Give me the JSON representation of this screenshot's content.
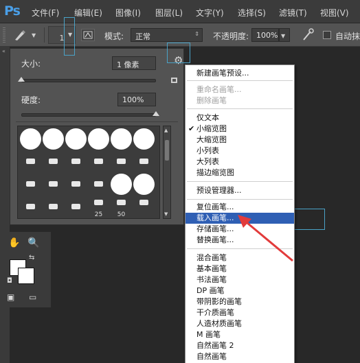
{
  "app": {
    "logo": "Ps"
  },
  "menubar": {
    "items": [
      "文件(F)",
      "编辑(E)",
      "图像(I)",
      "图层(L)",
      "文字(Y)",
      "选择(S)",
      "滤镜(T)",
      "视图(V)"
    ]
  },
  "options_bar": {
    "brush_size": "1",
    "mode_label": "模式:",
    "mode_value": "正常",
    "opacity_label": "不透明度:",
    "opacity_value": "100%",
    "auto_label": "自动抹"
  },
  "brush_panel": {
    "size_label": "大小:",
    "size_value": "1 像素",
    "hardness_label": "硬度:",
    "hardness_value": "100%",
    "size_fraction": 0.0,
    "hardness_fraction": 1.0,
    "thumb_numbers": [
      "25",
      "50"
    ]
  },
  "dropdown": {
    "items": [
      {
        "label": "新建画笔预设...",
        "state": "normal"
      },
      {
        "label": "重命名画笔...",
        "state": "disabled"
      },
      {
        "label": "删除画笔",
        "state": "disabled"
      },
      {
        "label": "仅文本",
        "state": "normal"
      },
      {
        "label": "小缩览图",
        "state": "checked"
      },
      {
        "label": "大缩览图",
        "state": "normal"
      },
      {
        "label": "小列表",
        "state": "normal"
      },
      {
        "label": "大列表",
        "state": "normal"
      },
      {
        "label": "描边缩览图",
        "state": "normal"
      },
      {
        "label": "预设管理器...",
        "state": "normal"
      },
      {
        "label": "复位画笔...",
        "state": "normal"
      },
      {
        "label": "载入画笔...",
        "state": "selected"
      },
      {
        "label": "存储画笔...",
        "state": "normal"
      },
      {
        "label": "替换画笔...",
        "state": "normal"
      },
      {
        "label": "混合画笔",
        "state": "normal"
      },
      {
        "label": "基本画笔",
        "state": "normal"
      },
      {
        "label": "书法画笔",
        "state": "normal"
      },
      {
        "label": "DP 画笔",
        "state": "normal"
      },
      {
        "label": "带阴影的画笔",
        "state": "normal"
      },
      {
        "label": "干介质画笔",
        "state": "normal"
      },
      {
        "label": "人造材质画笔",
        "state": "normal"
      },
      {
        "label": "M 画笔",
        "state": "normal"
      },
      {
        "label": "自然画笔 2",
        "state": "normal"
      },
      {
        "label": "自然画笔",
        "state": "normal"
      }
    ]
  },
  "colors": {
    "accent": "#2f5fb4",
    "highlight": "#4aa3c8",
    "annotation_arrow": "#e23b3b"
  }
}
